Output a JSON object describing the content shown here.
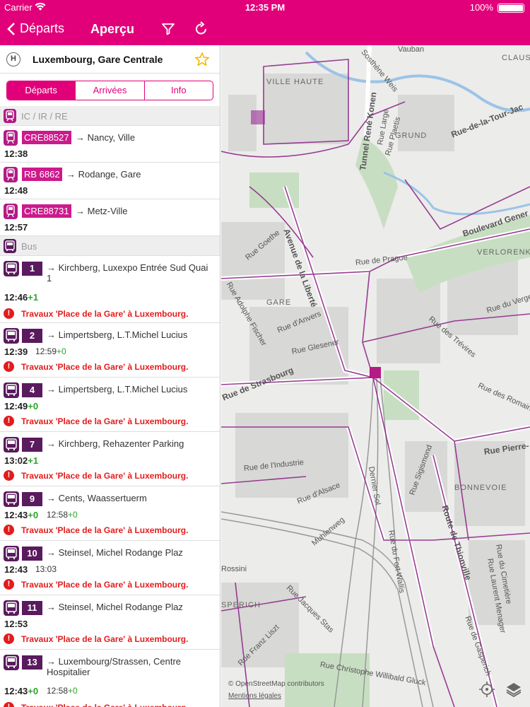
{
  "status": {
    "carrier": "Carrier",
    "time": "12:35 PM",
    "battery": "100%"
  },
  "nav": {
    "back": "Départs",
    "title": "Aperçu"
  },
  "station": {
    "badge": "H",
    "name": "Luxembourg, Gare Centrale"
  },
  "tabs": [
    "Départs",
    "Arrivées",
    "Info"
  ],
  "sections": {
    "train": "IC / IR / RE",
    "bus": "Bus"
  },
  "trains": [
    {
      "line": "CRE88527",
      "dest": "→ Nancy, Ville",
      "time": "12:38"
    },
    {
      "line": "RB 6862",
      "dest": "→ Rodange, Gare",
      "time": "12:48"
    },
    {
      "line": "CRE88731",
      "dest": "→ Metz-Ville",
      "time": "12:57"
    }
  ],
  "notice": "Travaux 'Place de la Gare' à Luxembourg.",
  "buses": [
    {
      "line": "1",
      "dest": "→ Kirchberg, Luxexpo Entrée Sud Quai 1",
      "time": "12:46",
      "delay": "+1",
      "rt": "",
      "rt_delay": ""
    },
    {
      "line": "2",
      "dest": "→ Limpertsberg, L.T.Michel Lucius",
      "time": "12:39",
      "delay": "",
      "rt": "12:59",
      "rt_delay": "+0"
    },
    {
      "line": "4",
      "dest": "→ Limpertsberg, L.T.Michel Lucius",
      "time": "12:49",
      "delay": "+0",
      "rt": "",
      "rt_delay": ""
    },
    {
      "line": "7",
      "dest": "→ Kirchberg, Rehazenter Parking",
      "time": "13:02",
      "delay": "+1",
      "rt": "",
      "rt_delay": ""
    },
    {
      "line": "9",
      "dest": "→ Cents, Waassertuerm",
      "time": "12:43",
      "delay": "+0",
      "rt": "12:58",
      "rt_delay": "+0"
    },
    {
      "line": "10",
      "dest": "→ Steinsel, Michel Rodange Plaz",
      "time": "12:43",
      "delay": "",
      "rt": "13:03",
      "rt_delay": ""
    },
    {
      "line": "11",
      "dest": "→ Steinsel, Michel Rodange Plaz",
      "time": "12:53",
      "delay": "",
      "rt": "",
      "rt_delay": ""
    },
    {
      "line": "13",
      "dest": "→ Luxembourg/Strassen, Centre Hospitalier",
      "time": "12:43",
      "delay": "+0",
      "rt": "12:58",
      "rt_delay": "+0"
    }
  ],
  "map": {
    "districts": [
      "VILLE HAUTE",
      "GRUND",
      "CLAUS",
      "VERLORENK",
      "GARE",
      "BONNEVOIE",
      "SPERICH"
    ],
    "streets": [
      "Tunnel René Konen",
      "Avenue de la Liberté",
      "Rue de Strasbourg",
      "Route de Thionville",
      "Boulevard Gener",
      "Rue-de-la-Tour-Jac",
      "Rue Pierre-",
      "Rue des Romains",
      "Rue du Verger",
      "Rue de Prague",
      "Rue Goethe",
      "Rue d'Anvers",
      "Rue Glesener",
      "Rue de l'Industrie",
      "Rue d'Alsace",
      "Rue Sigismond",
      "Muhlenweg",
      "Rue Jacques Stas",
      "Rue Franz Liszt",
      "Rue Christophe Willibald Gluck",
      "Rue Adolphe Fischer",
      "Rue des Trévires",
      "Rue Laurent Menager",
      "Rossini",
      "Dernier Sol",
      "Rue Large",
      "Rue Plaetis",
      "Sosthène Weis",
      "Rue du Cimetière",
      "Rue de Gasperich",
      "Vauban",
      "Rue du Fort Wallis"
    ],
    "credit": "© OpenStreetMap contributors",
    "legal": "Mentions légales"
  },
  "colors": {
    "brand": "#e2007a",
    "train": "#cc1a8c",
    "bus": "#5a1a5e",
    "alert": "#e41b1b",
    "delay": "#2aa52a"
  }
}
